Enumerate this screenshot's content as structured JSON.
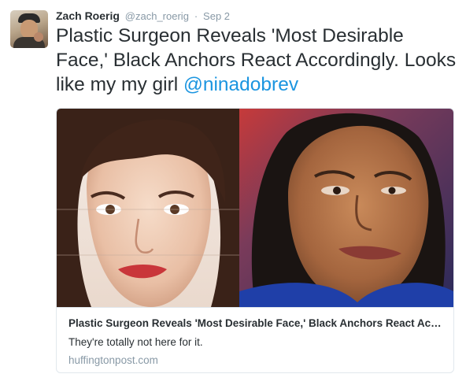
{
  "tweet": {
    "author_name": "Zach Roerig",
    "author_handle": "@zach_roerig",
    "separator": "·",
    "date": "Sep 2",
    "text": "Plastic Surgeon Reveals 'Most Desirable Face,' Black Anchors React Accordingly. Looks like my my girl ",
    "mention": "@ninadobrev"
  },
  "card": {
    "title": "Plastic Surgeon Reveals 'Most Desirable Face,' Black Anchors React Accordingly",
    "description": "They're totally not here for it.",
    "domain": "huffingtonpost.com"
  },
  "colors": {
    "link": "#1b95e0",
    "meta_text": "#8899a6",
    "body_text": "#292f33",
    "card_border": "#e1e8ed",
    "right_image_bg": "#1f3fa8"
  },
  "icons": {
    "avatar": "user-avatar-photo"
  }
}
